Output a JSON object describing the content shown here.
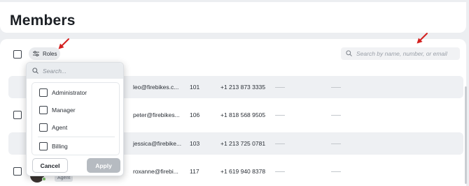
{
  "page": {
    "title": "Members"
  },
  "toolbar": {
    "roles_label": "Roles",
    "search_placeholder": "Search by name, number, or email"
  },
  "rows": [
    {
      "email": "leo@firebikes.c...",
      "ext": "101",
      "phone": "+1 213 873 3335"
    },
    {
      "email": "peter@firebikes...",
      "ext": "106",
      "phone": "+1 818 568 9505"
    },
    {
      "email": "jessica@firebike...",
      "ext": "103",
      "phone": "+1 213 725 0781"
    },
    {
      "email": "roxanne@firebi...",
      "ext": "117",
      "phone": "+1 619 940 8378",
      "role_badge": "Agent"
    }
  ],
  "roles_dropdown": {
    "search_placeholder": "Search...",
    "options": [
      {
        "label": "Administrator",
        "checked": false
      },
      {
        "label": "Manager",
        "checked": false
      },
      {
        "label": "Agent",
        "checked": false
      },
      {
        "label": "Billing",
        "checked": false
      }
    ],
    "cancel_label": "Cancel",
    "apply_label": "Apply"
  },
  "colors": {
    "annotation_arrow": "#d4201f",
    "apply_disabled": "#b6bbc1",
    "online_status": "#7dc56b"
  }
}
